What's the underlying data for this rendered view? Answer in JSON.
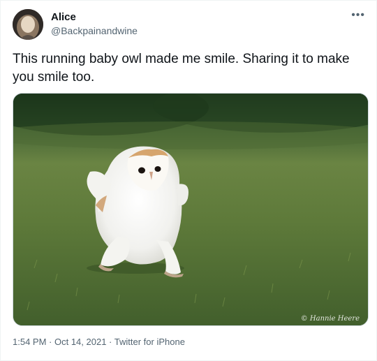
{
  "author": {
    "name": "Alice",
    "handle": "@Backpainandwine"
  },
  "tweet": {
    "text": "This running baby owl made me smile. Sharing it to make you smile too.",
    "image_credit": "© Hannie Heere"
  },
  "meta": {
    "time": "1:54 PM",
    "separator1": " · ",
    "date": "Oct 14, 2021",
    "separator2": " · ",
    "source": "Twitter for iPhone"
  },
  "icons": {
    "more": "more-horizontal-icon"
  },
  "colors": {
    "text_primary": "#0f1419",
    "text_secondary": "#536471",
    "border": "#cfd9de"
  }
}
